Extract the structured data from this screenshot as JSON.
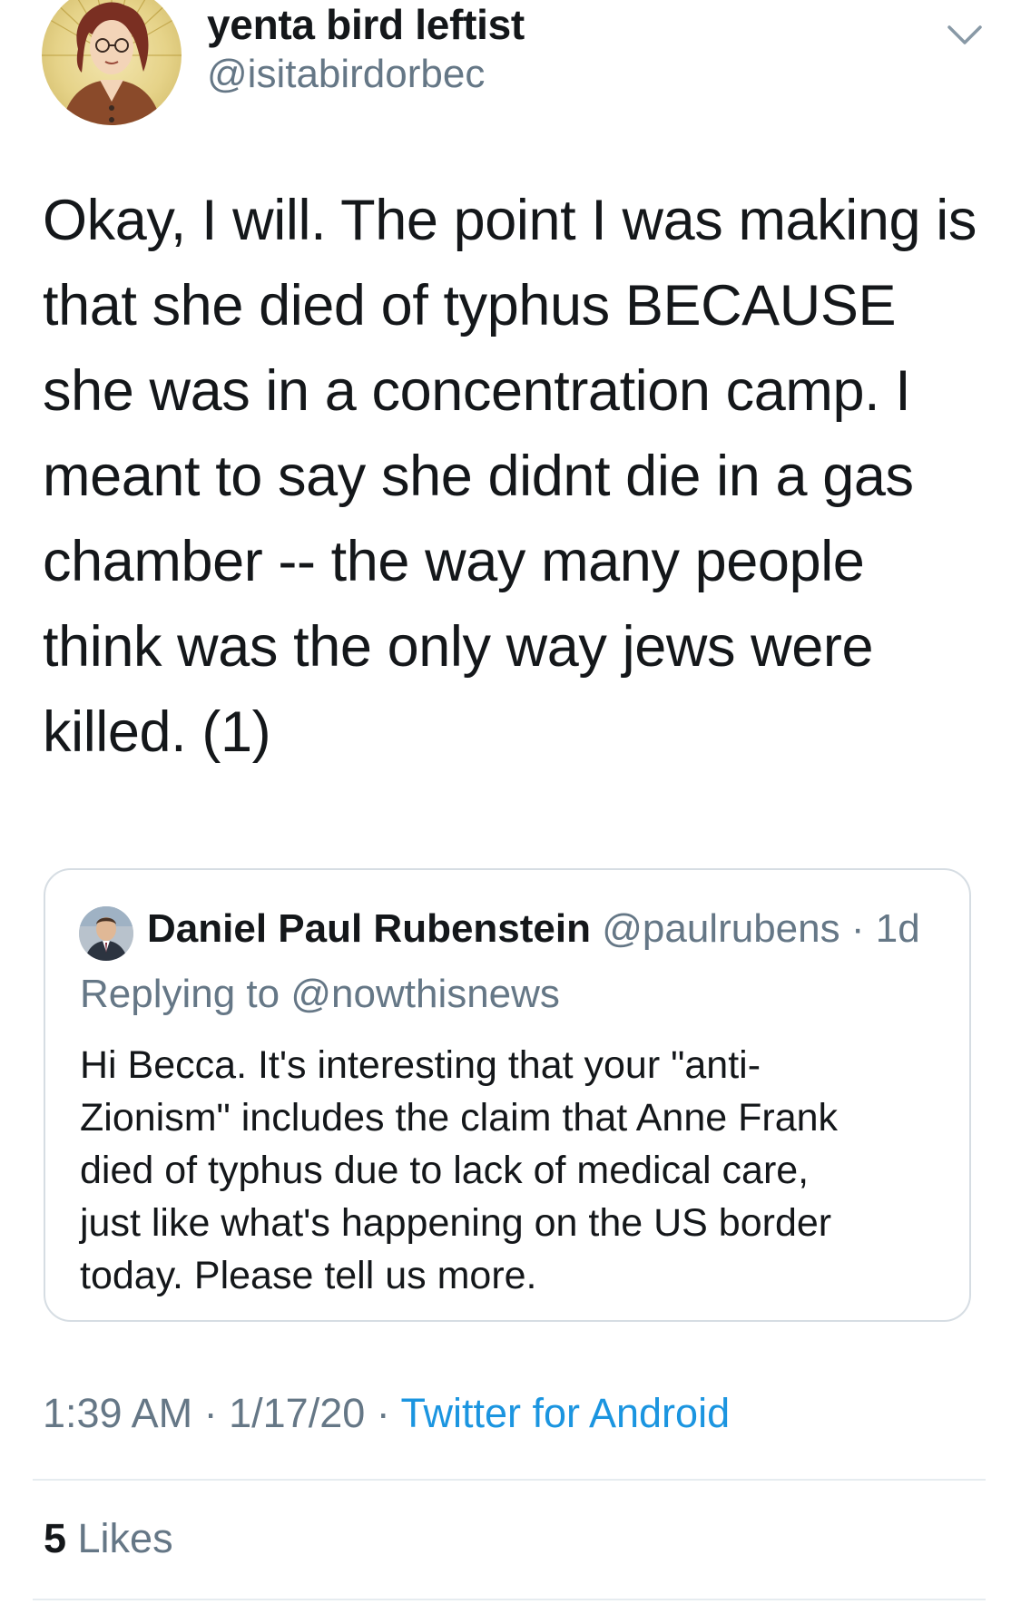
{
  "author": {
    "display_name": "yenta bird leftist",
    "handle": "@isitabirdorbec",
    "avatar_icon": "illustrated-portrait-avatar"
  },
  "menu_icon": "chevron-down-icon",
  "tweet": {
    "lines": [
      "Okay, I will. The point I was making is",
      "that she died of typhus BECAUSE",
      "she was in a concentration camp. I",
      "meant to say she didnt die in a gas",
      "chamber -- the way many people",
      "think was the only way jews were",
      "killed. (1)"
    ]
  },
  "quoted_tweet": {
    "name": "Daniel Paul Rubenstein",
    "handle": "@paulrubens",
    "separator": " · ",
    "age": "1d",
    "replying_prefix": "Replying to ",
    "replying_to": "@nowthisnews",
    "lines": [
      "Hi Becca. It's interesting that your \"anti-",
      "Zionism\" includes the claim that Anne Frank",
      "died of typhus due to lack of medical care,",
      "just like what's happening on the US border",
      "today. Please tell us more."
    ]
  },
  "meta": {
    "time": "1:39 AM",
    "date": "1/17/20",
    "separator": " · ",
    "source": "Twitter for Android"
  },
  "likes": {
    "count": "5",
    "label": " Likes"
  },
  "colors": {
    "text": "#14171a",
    "secondary": "#657786",
    "link": "#1b95e0",
    "border": "#d6dde3"
  }
}
